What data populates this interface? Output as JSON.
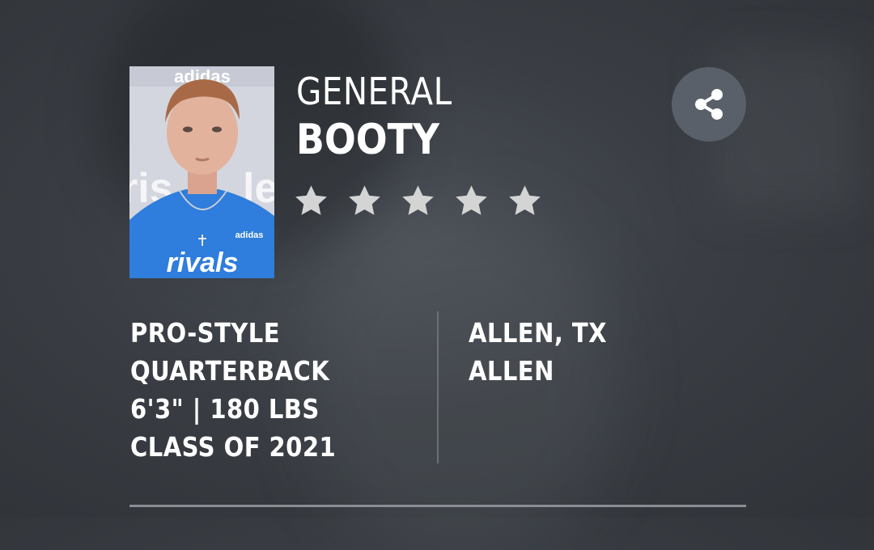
{
  "player": {
    "first_name": "GENERAL",
    "last_name": "BOOTY",
    "stars": 5,
    "position_line1": "PRO-STYLE",
    "position_line2": "QUARTERBACK",
    "measurements": "6'3\" | 180 LBS",
    "class_year": "CLASS OF 2021",
    "hometown": "ALLEN, TX",
    "school": "ALLEN"
  },
  "photo": {
    "shirt_text": "rivals",
    "logo_text": "adidas"
  },
  "actions": {
    "share_icon": "share-icon"
  },
  "colors": {
    "background": "#3a3e44",
    "star": "#d4d4d4",
    "share_button": "#596069",
    "text": "#ffffff"
  }
}
